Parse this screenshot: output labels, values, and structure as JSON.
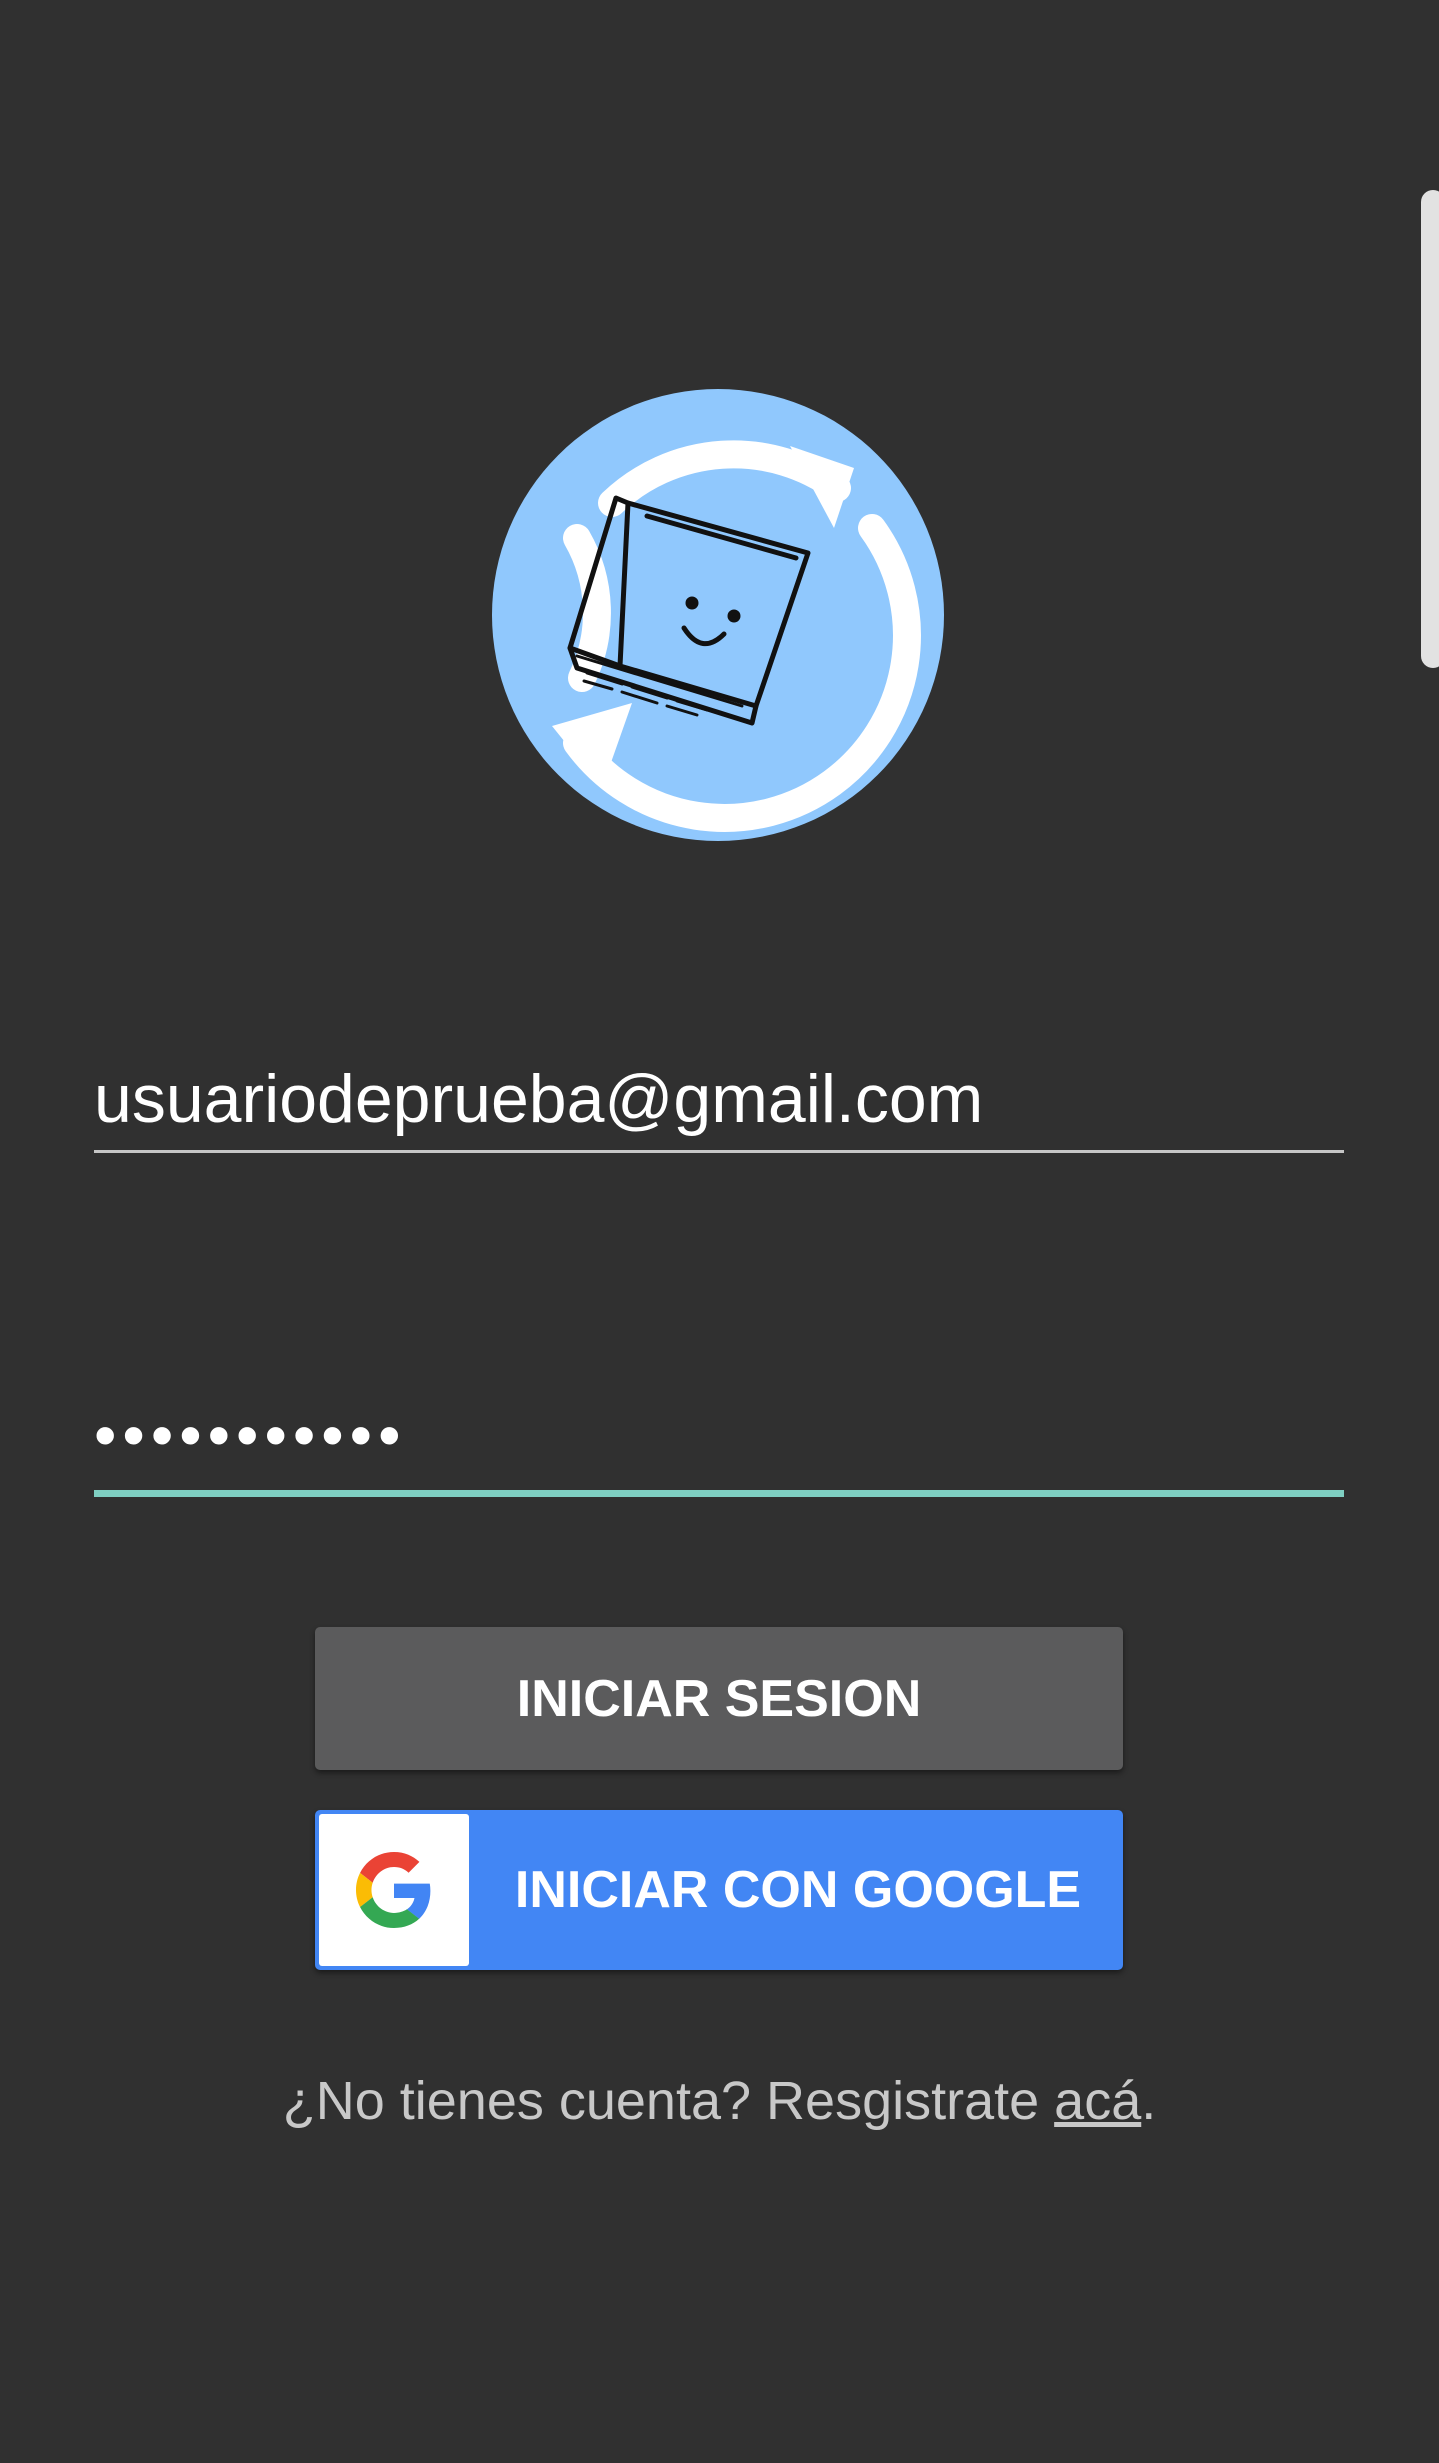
{
  "app": {
    "logo_icon": "book-sync-logo-icon",
    "logo_color": "#90c8fd"
  },
  "login_form": {
    "email_value": "usuariodeprueba@gmail.com",
    "password_value": "•••••••••••",
    "password_focus_color": "#7fcfc2"
  },
  "buttons": {
    "login_label": "INICIAR SESION",
    "google_label": "INICIAR CON GOOGLE",
    "google_icon": "google-g-icon",
    "google_color": "#4286f4"
  },
  "register": {
    "prompt": "¿No tienes cuenta? Resgistrate ",
    "link_label": "acá",
    "suffix": "."
  }
}
